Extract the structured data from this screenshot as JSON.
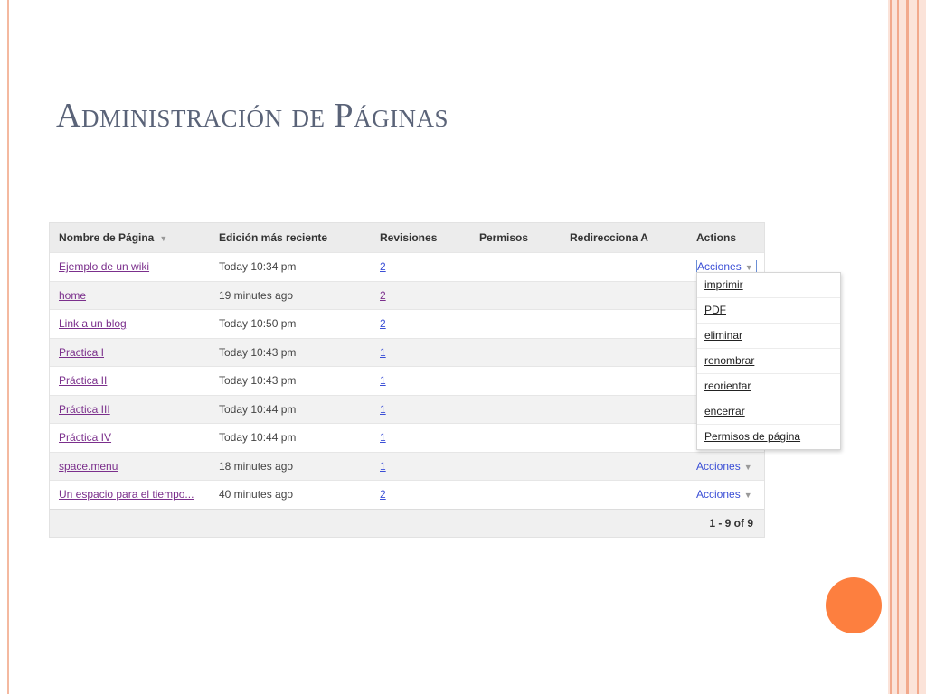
{
  "slide": {
    "title": "Administración de Páginas"
  },
  "table": {
    "headers": {
      "name": "Nombre de Página",
      "recent": "Edición más reciente",
      "revisions": "Revisiones",
      "permissions": "Permisos",
      "redirect": "Redirecciona A",
      "actions": "Actions"
    },
    "rows": [
      {
        "name": "Ejemplo de un wiki",
        "recent": "Today 10:34 pm",
        "revisions": "2",
        "actions": "Acciones"
      },
      {
        "name": "home",
        "recent": "19 minutes ago",
        "revisions": "2",
        "actions": ""
      },
      {
        "name": "Link a un blog",
        "recent": "Today 10:50 pm",
        "revisions": "2",
        "actions": ""
      },
      {
        "name": "Practica I",
        "recent": "Today 10:43 pm",
        "revisions": "1",
        "actions": ""
      },
      {
        "name": "Práctica II",
        "recent": "Today 10:43 pm",
        "revisions": "1",
        "actions": ""
      },
      {
        "name": "Práctica III",
        "recent": "Today 10:44 pm",
        "revisions": "1",
        "actions": ""
      },
      {
        "name": "Práctica IV",
        "recent": "Today 10:44 pm",
        "revisions": "1",
        "actions": ""
      },
      {
        "name": "space.menu",
        "recent": "18 minutes ago",
        "revisions": "1",
        "actions": "Acciones"
      },
      {
        "name": "Un espacio para el tiempo...",
        "recent": "40 minutes ago",
        "revisions": "2",
        "actions": "Acciones"
      }
    ],
    "pager": "1 - 9 of 9"
  },
  "menu": {
    "items": [
      "imprimir",
      "PDF",
      "eliminar",
      "renombrar",
      "reorientar",
      "encerrar",
      "Permisos de página"
    ]
  },
  "colors": {
    "accent_orange": "#fd7f3f",
    "stripe": "#f2a98c",
    "title": "#5a6378",
    "link_purple": "#7b2f8c",
    "link_blue": "#3b4fd6"
  }
}
